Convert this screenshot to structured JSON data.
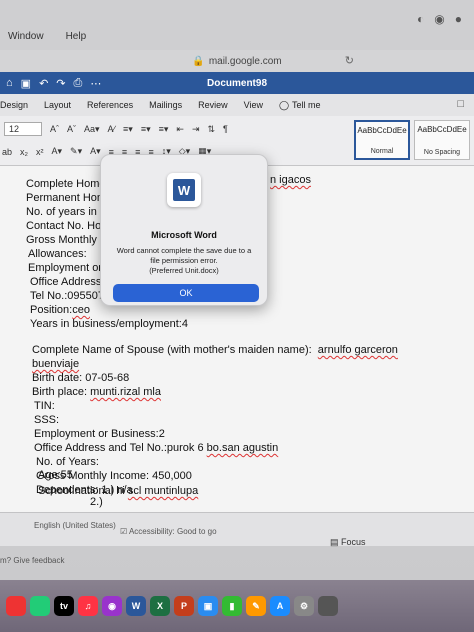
{
  "menubar": {
    "items": [
      "Window",
      "Help"
    ]
  },
  "browser": {
    "url": "mail.google.com"
  },
  "word": {
    "title": "Document98",
    "tabs": [
      "Design",
      "Layout",
      "References",
      "Mailings",
      "Review",
      "View"
    ],
    "tell_me": "Tell me",
    "font_size": "12",
    "styles": [
      {
        "preview": "AaBbCcDdEe",
        "name": "Normal",
        "selected": true
      },
      {
        "preview": "AaBbCcDdEe",
        "name": "No Spacing",
        "selected": false
      }
    ]
  },
  "document": {
    "lines": [
      "Complete Home",
      "Permanent Hon",
      "No. of years in l",
      "Contact No. Ho",
      "Gross Monthly l",
      "Allowances:",
      "Employment or",
      "Office Address:",
      "Tel No.:095507",
      "Position:",
      "Years in business/employment:4"
    ],
    "name_fragment": "n igacos",
    "position_value": "ceo",
    "spouse_label": "Complete Name of Spouse (with mother's maiden name):",
    "spouse_name": "arnulfo garceron",
    "spouse_name_2": "buenviaje",
    "birth_date": "Birth date: 07-05-68",
    "birth_place_label": "Birth place:",
    "birth_place": "munti.rizal mla",
    "tin": "TIN:",
    "sss": "SSS:",
    "employment": "Employment or Business:2",
    "office_label": "Office Address and Tel No.:purok 6",
    "office_place": "bo.san agustin",
    "years": "No. of Years:",
    "income": "Gross Monthly Income: 450,000",
    "dependents": "Dependents: 1.) n/a",
    "dependents_2": "2.)",
    "age": "Age:55",
    "school_label": "School:national hi",
    "school_value": "scl muntinlupa"
  },
  "status": {
    "language": "English (United States)",
    "accessibility": "Accessibility: Good to go",
    "focus": "Focus"
  },
  "feedback": "m? Give feedback",
  "dialog": {
    "title": "Microsoft Word",
    "message": "Word cannot complete the save due to a file permission error.",
    "file": "(Preferred Unit.docx)",
    "ok_label": "OK"
  },
  "colors": {
    "word_blue": "#2b579a",
    "ok_blue": "#2a63d4"
  }
}
